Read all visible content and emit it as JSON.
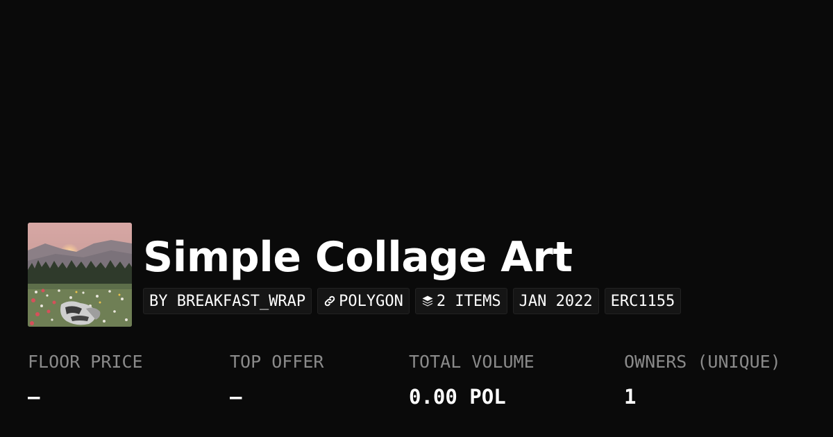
{
  "collection": {
    "title": "Simple Collage Art",
    "thumbnail_icon": "collage-image"
  },
  "tags": {
    "creator": "BY BREAKFAST_WRAP",
    "chain": "POLYGON",
    "chain_icon": "link-icon",
    "items": "2 ITEMS",
    "items_icon": "layers-icon",
    "date": "JAN 2022",
    "standard": "ERC1155"
  },
  "stats": [
    {
      "label": "FLOOR PRICE",
      "value": "–"
    },
    {
      "label": "TOP OFFER",
      "value": "–"
    },
    {
      "label": "TOTAL VOLUME",
      "value": "0.00 POL"
    },
    {
      "label": "OWNERS (UNIQUE)",
      "value": "1"
    }
  ],
  "colors": {
    "background": "#0a0a0a",
    "text": "#ffffff",
    "muted": "#8a8a8a",
    "tag_background": "#151515"
  }
}
